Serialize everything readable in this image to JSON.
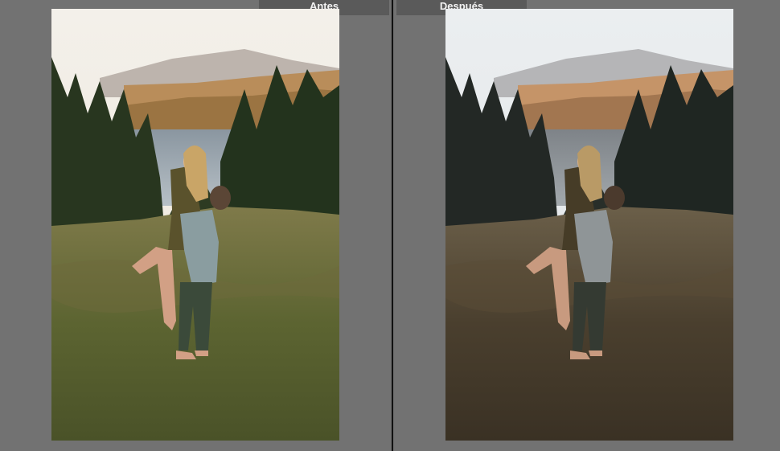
{
  "labels": {
    "before": "Antes",
    "after": "Después"
  },
  "colors": {
    "workspace": "#727272",
    "label_bg": "#5a5a5a",
    "label_text": "#f2f2f2",
    "divider": "#111111"
  },
  "images": {
    "before": {
      "description_icon": "photo-couple-meadow-original"
    },
    "after": {
      "description_icon": "photo-couple-meadow-edited"
    }
  }
}
